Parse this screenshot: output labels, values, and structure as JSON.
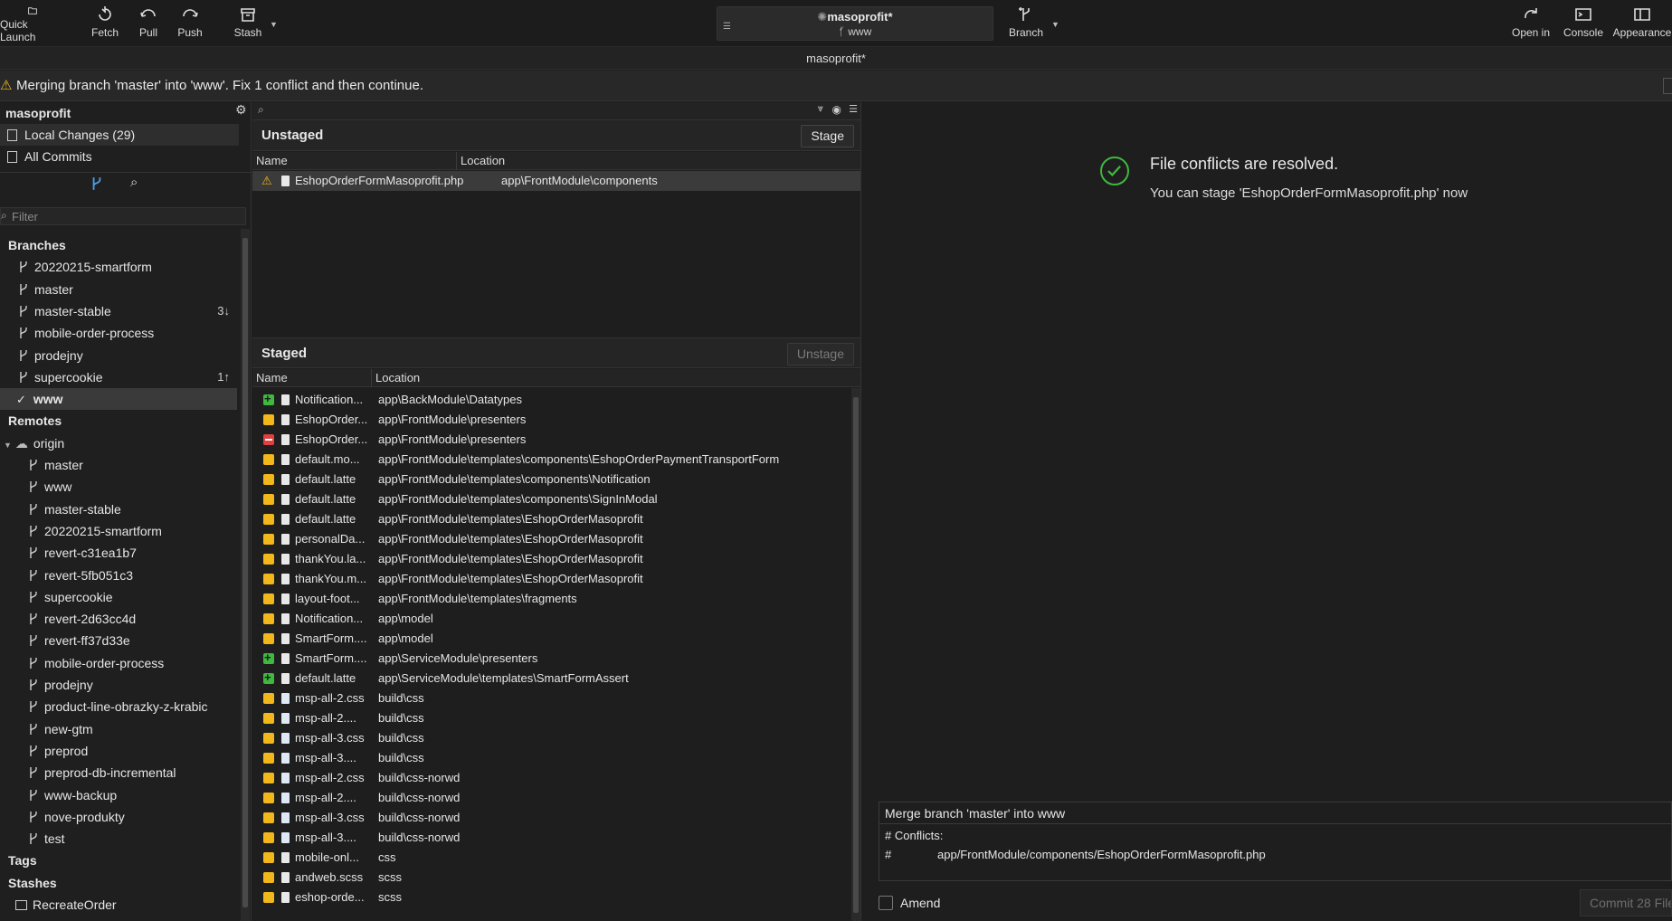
{
  "toolbar": {
    "quick_launch": "Quick Launch",
    "fetch": "Fetch",
    "pull": "Pull",
    "push": "Push",
    "stash": "Stash",
    "repo_name": "masoprofit*",
    "repo_branch": "www",
    "branch": "Branch",
    "open_in": "Open in",
    "console": "Console",
    "appearance": "Appearance"
  },
  "window_title": "masoprofit*",
  "banner": {
    "message": "Merging branch 'master' into 'www'. Fix 1 conflict and then continue."
  },
  "sidebar": {
    "repo": "masoprofit",
    "local_changes": "Local Changes (29)",
    "all_commits": "All Commits",
    "filter_placeholder": "Filter",
    "branches_title": "Branches",
    "branches": [
      {
        "name": "20220215-smartform",
        "badge": ""
      },
      {
        "name": "master",
        "badge": ""
      },
      {
        "name": "master-stable",
        "badge": "3↓"
      },
      {
        "name": "mobile-order-process",
        "badge": ""
      },
      {
        "name": "prodejny",
        "badge": ""
      },
      {
        "name": "supercookie",
        "badge": "1↑"
      },
      {
        "name": "www",
        "badge": ""
      }
    ],
    "remotes_title": "Remotes",
    "origin": "origin",
    "remotes": [
      "master",
      "www",
      "master-stable",
      "20220215-smartform",
      "revert-c31ea1b7",
      "revert-5fb051c3",
      "supercookie",
      "revert-2d63cc4d",
      "revert-ff37d33e",
      "mobile-order-process",
      "prodejny",
      "product-line-obrazky-z-krabic",
      "new-gtm",
      "preprod",
      "preprod-db-incremental",
      "www-backup",
      "nove-produkty",
      "test"
    ],
    "tags_title": "Tags",
    "stashes_title": "Stashes",
    "stashes": [
      "RecreateOrder"
    ]
  },
  "unstaged": {
    "title": "Unstaged",
    "stage_button": "Stage",
    "col_name": "Name",
    "col_location": "Location",
    "files": [
      {
        "name": "EshopOrderFormMasoprofit.php",
        "location": "app\\FrontModule\\components"
      }
    ]
  },
  "staged": {
    "title": "Staged",
    "unstage_button": "Unstage",
    "col_name": "Name",
    "col_location": "Location",
    "files": [
      {
        "status": "add",
        "icon": "doc",
        "name": "Notification...",
        "location": "app\\BackModule\\Datatypes"
      },
      {
        "status": "mod",
        "icon": "doc",
        "name": "EshopOrder...",
        "location": "app\\FrontModule\\presenters"
      },
      {
        "status": "del",
        "icon": "doc",
        "name": "EshopOrder...",
        "location": "app\\FrontModule\\presenters"
      },
      {
        "status": "mod",
        "icon": "doc",
        "name": "default.mo...",
        "location": "app\\FrontModule\\templates\\components\\EshopOrderPaymentTransportForm"
      },
      {
        "status": "mod",
        "icon": "doc",
        "name": "default.latte",
        "location": "app\\FrontModule\\templates\\components\\Notification"
      },
      {
        "status": "mod",
        "icon": "doc",
        "name": "default.latte",
        "location": "app\\FrontModule\\templates\\components\\SignInModal"
      },
      {
        "status": "mod",
        "icon": "doc",
        "name": "default.latte",
        "location": "app\\FrontModule\\templates\\EshopOrderMasoprofit"
      },
      {
        "status": "mod",
        "icon": "doc",
        "name": "personalDa...",
        "location": "app\\FrontModule\\templates\\EshopOrderMasoprofit"
      },
      {
        "status": "mod",
        "icon": "doc",
        "name": "thankYou.la...",
        "location": "app\\FrontModule\\templates\\EshopOrderMasoprofit"
      },
      {
        "status": "mod",
        "icon": "doc",
        "name": "thankYou.m...",
        "location": "app\\FrontModule\\templates\\EshopOrderMasoprofit"
      },
      {
        "status": "mod",
        "icon": "doc",
        "name": "layout-foot...",
        "location": "app\\FrontModule\\templates\\fragments"
      },
      {
        "status": "mod",
        "icon": "doc",
        "name": "Notification...",
        "location": "app\\model"
      },
      {
        "status": "mod",
        "icon": "doc",
        "name": "SmartForm....",
        "location": "app\\model"
      },
      {
        "status": "add",
        "icon": "doc",
        "name": "SmartForm....",
        "location": "app\\ServiceModule\\presenters"
      },
      {
        "status": "add",
        "icon": "doc",
        "name": "default.latte",
        "location": "app\\ServiceModule\\templates\\SmartFormAssert"
      },
      {
        "status": "mod",
        "icon": "css",
        "name": "msp-all-2.css",
        "location": "build\\css"
      },
      {
        "status": "mod",
        "icon": "css",
        "name": "msp-all-2....",
        "location": "build\\css"
      },
      {
        "status": "mod",
        "icon": "css",
        "name": "msp-all-3.css",
        "location": "build\\css"
      },
      {
        "status": "mod",
        "icon": "css",
        "name": "msp-all-3....",
        "location": "build\\css"
      },
      {
        "status": "mod",
        "icon": "css",
        "name": "msp-all-2.css",
        "location": "build\\css-norwd"
      },
      {
        "status": "mod",
        "icon": "css",
        "name": "msp-all-2....",
        "location": "build\\css-norwd"
      },
      {
        "status": "mod",
        "icon": "css",
        "name": "msp-all-3.css",
        "location": "build\\css-norwd"
      },
      {
        "status": "mod",
        "icon": "css",
        "name": "msp-all-3....",
        "location": "build\\css-norwd"
      },
      {
        "status": "mod",
        "icon": "doc",
        "name": "mobile-onl...",
        "location": "css"
      },
      {
        "status": "mod",
        "icon": "doc",
        "name": "andweb.scss",
        "location": "scss"
      },
      {
        "status": "mod",
        "icon": "doc",
        "name": "eshop-orde...",
        "location": "scss"
      }
    ]
  },
  "right": {
    "resolved_title": "File conflicts are resolved.",
    "resolved_sub": "You can stage 'EshopOrderFormMasoprofit.php' now",
    "commit_subject": "Merge branch 'master' into www",
    "commit_body_1": "# Conflicts:",
    "commit_body_2_hash": "#",
    "commit_body_2_path": "app/FrontModule/components/EshopOrderFormMasoprofit.php",
    "amend": "Amend",
    "commit_button": "Commit 28 File"
  },
  "colors": {
    "accent_green": "#3fb83f",
    "modified": "#f2b71b",
    "deleted": "#e04040",
    "warning": "#f2b71b"
  }
}
